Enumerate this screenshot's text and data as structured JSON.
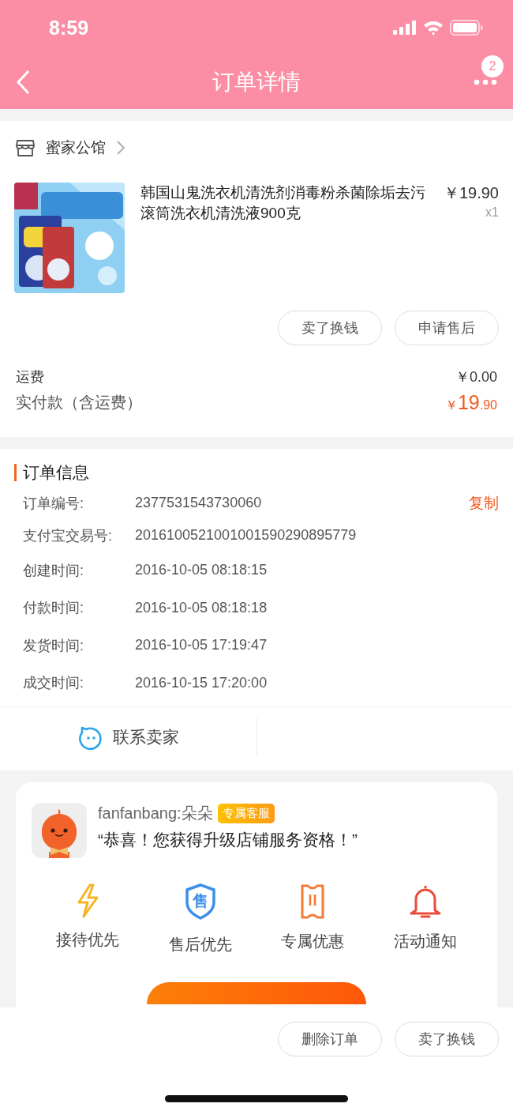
{
  "status_bar": {
    "time": "8:59"
  },
  "nav": {
    "title": "订单详情",
    "more_badge": "2"
  },
  "store": {
    "name": "蜜家公馆"
  },
  "product": {
    "title": "韩国山鬼洗衣机清洗剂消毒粉杀菌除垢去污滚筒洗衣机清洗液900克",
    "price": "￥19.90",
    "quantity": "x1"
  },
  "product_actions": [
    "卖了换钱",
    "申请售后"
  ],
  "costs": {
    "shipping_label": "运费",
    "shipping_value": "￥0.00",
    "paid_label": "实付款（含运费）",
    "paid_currency": "￥",
    "paid_int": "19",
    "paid_dec": ".90"
  },
  "order_info": {
    "title": "订单信息",
    "copy": "复制",
    "rows": [
      {
        "label": "订单编号:",
        "value": "2377531543730060"
      },
      {
        "label": "支付宝交易号:",
        "value": "2016100521001001590290895779"
      },
      {
        "label": "创建时间:",
        "value": "2016-10-05 08:18:15"
      },
      {
        "label": "付款时间:",
        "value": "2016-10-05 08:18:18"
      },
      {
        "label": "发货时间:",
        "value": "2016-10-05 17:19:47"
      },
      {
        "label": "成交时间:",
        "value": "2016-10-15 17:20:00"
      }
    ]
  },
  "contact": {
    "label": "联系卖家"
  },
  "upgrade": {
    "sender": "fanfanbang:朵朵",
    "tag": "专属客服",
    "message": "“恭喜！您获得升级店铺服务资格！”",
    "perks": [
      {
        "kind": "lightning",
        "label": "接待优先"
      },
      {
        "kind": "shield",
        "label": "售后优先",
        "glyph": "售"
      },
      {
        "kind": "ticket",
        "label": "专属优惠"
      },
      {
        "kind": "bell",
        "label": "活动通知"
      }
    ]
  },
  "bottom_actions": [
    "删除订单",
    "卖了换钱"
  ]
}
